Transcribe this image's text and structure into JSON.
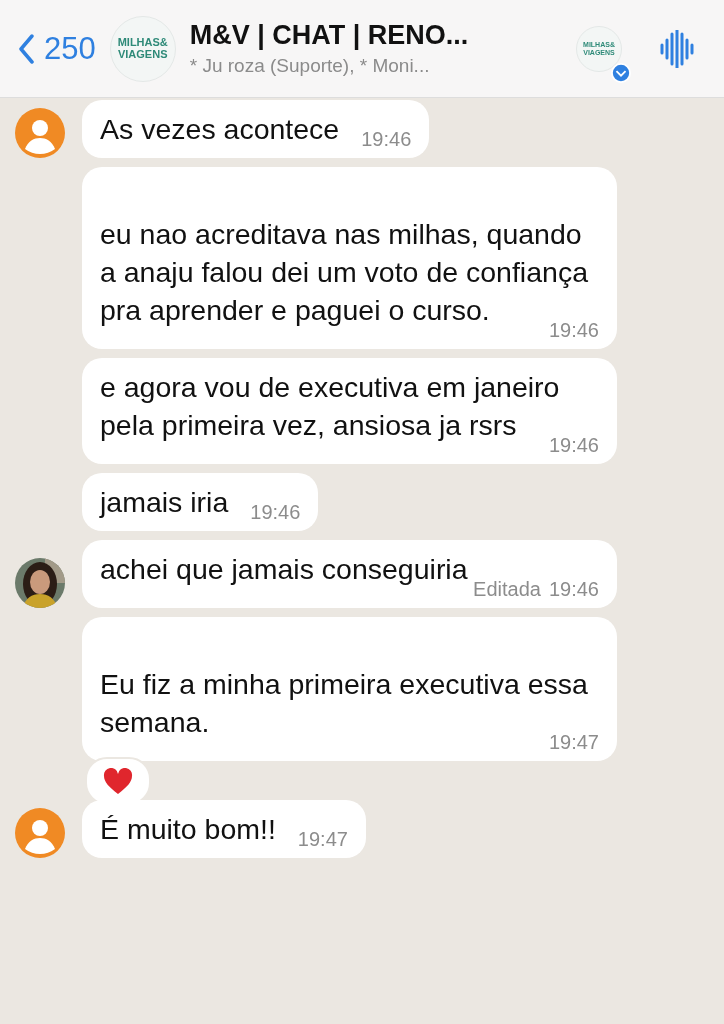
{
  "header": {
    "back_count": "250",
    "group_logo": {
      "line1": "MILHAS",
      "amp": "&",
      "line2": "VIAGENS"
    },
    "title": "M&V | CHAT | RENO...",
    "subtitle": "* Ju roza (Suporte), * Moni...",
    "community_logo": {
      "line1": "MILHAS",
      "amp": "&",
      "line2": "VIAGENS"
    }
  },
  "messages": [
    {
      "text": "As vezes acontece",
      "time": "19:46",
      "avatar": {
        "kind": "default"
      },
      "blank_first_line": false
    },
    {
      "text": "eu nao acreditava nas milhas, quando a anaju falou dei um voto de confiança pra aprender e paguei o curso.",
      "time": "19:46",
      "blank_first_line": true
    },
    {
      "text": "e agora vou de executiva em janeiro pela primeira vez, ansiosa ja rsrs",
      "time": "19:46",
      "blank_first_line": false
    },
    {
      "text": "jamais iria",
      "time": "19:46",
      "blank_first_line": false
    },
    {
      "text": "achei que jamais conseguiria",
      "edited": "Editada",
      "time": "19:46",
      "blank_first_line": false
    },
    {
      "text": "Eu fiz a minha primeira executiva essa semana.",
      "time": "19:47",
      "blank_first_line": true,
      "reaction": {
        "kind": "heart"
      }
    },
    {
      "text": "É muito bom!!",
      "time": "19:47",
      "avatar": {
        "kind": "default"
      },
      "blank_first_line": false
    }
  ]
}
